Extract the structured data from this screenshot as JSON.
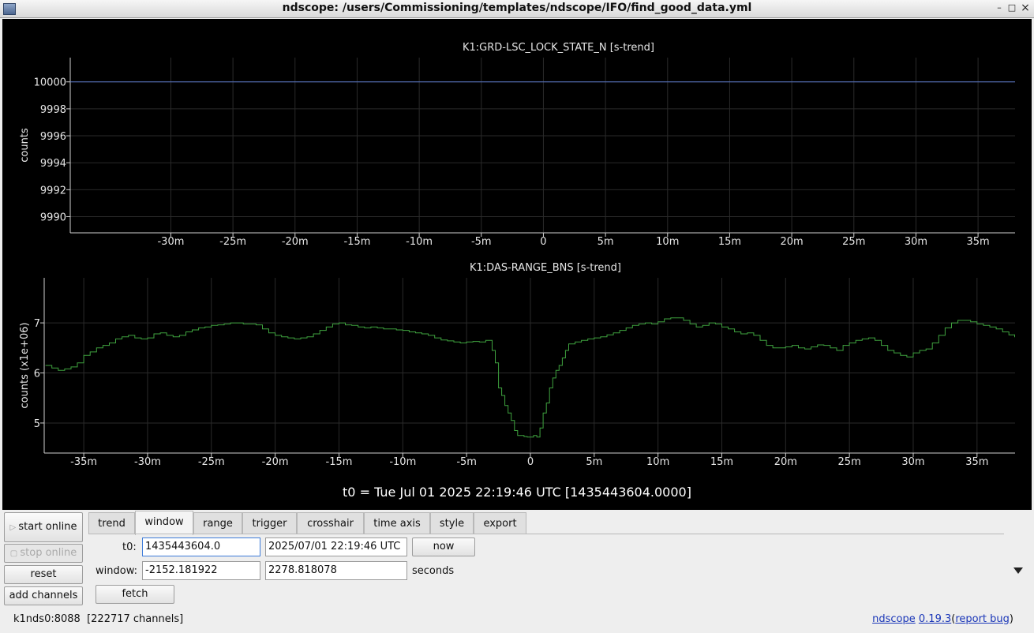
{
  "window": {
    "title": "ndscope: /users/Commissioning/templates/ndscope/IFO/find_good_data.yml",
    "minimize": "–",
    "maximize": "□",
    "close": "×"
  },
  "plots": [
    {
      "title": "K1:GRD-LSC_LOCK_STATE_N [s-trend]",
      "ylabel": "counts",
      "yticks": [
        "9990",
        "9992",
        "9994",
        "9996",
        "9998",
        "10000"
      ],
      "xticks": [
        "-30m",
        "-25m",
        "-20m",
        "-15m",
        "-10m",
        "-5m",
        "0",
        "5m",
        "10m",
        "15m",
        "20m",
        "25m",
        "30m",
        "35m"
      ]
    },
    {
      "title": "K1:DAS-RANGE_BNS [s-trend]",
      "ylabel": "counts (x1e+06)",
      "yticks": [
        "5",
        "6",
        "7"
      ],
      "xticks": [
        "-35m",
        "-30m",
        "-25m",
        "-20m",
        "-15m",
        "-10m",
        "-5m",
        "0",
        "5m",
        "10m",
        "15m",
        "20m",
        "25m",
        "30m",
        "35m"
      ]
    }
  ],
  "t0_label": "t0 = Tue Jul 01 2025 22:19:46 UTC [1435443604.0000]",
  "chart_data": [
    {
      "type": "line",
      "title": "K1:GRD-LSC_LOCK_STATE_N [s-trend]",
      "ylabel": "counts",
      "xunit": "minutes",
      "xlim": [
        -38.1,
        37.98
      ],
      "ylim": [
        9988.8,
        10001.8
      ],
      "grid": true,
      "color": "#5a78c8",
      "x": [
        -38.1,
        37.98
      ],
      "y": [
        10000,
        10000
      ]
    },
    {
      "type": "line",
      "title": "K1:DAS-RANGE_BNS [s-trend]",
      "ylabel": "counts (x1e+06)",
      "xunit": "minutes",
      "xlim": [
        -38.1,
        37.98
      ],
      "ylim": [
        4.4,
        7.9
      ],
      "grid": true,
      "color": "#3fa33f",
      "x": [
        -38.0,
        -37.5,
        -37.0,
        -36.5,
        -36.0,
        -35.5,
        -35.0,
        -34.5,
        -34.0,
        -33.5,
        -33.0,
        -32.5,
        -32.0,
        -31.5,
        -31.0,
        -30.5,
        -30.0,
        -29.5,
        -29.0,
        -28.5,
        -28.0,
        -27.5,
        -27.0,
        -26.5,
        -26.0,
        -25.5,
        -25.0,
        -24.5,
        -24.0,
        -23.5,
        -23.0,
        -22.5,
        -22.0,
        -21.5,
        -21.0,
        -20.5,
        -20.0,
        -19.5,
        -19.0,
        -18.5,
        -18.0,
        -17.5,
        -17.0,
        -16.5,
        -16.0,
        -15.5,
        -15.0,
        -14.5,
        -14.0,
        -13.5,
        -13.0,
        -12.5,
        -12.0,
        -11.5,
        -11.0,
        -10.5,
        -10.0,
        -9.5,
        -9.0,
        -8.5,
        -8.0,
        -7.5,
        -7.0,
        -6.5,
        -6.0,
        -5.5,
        -5.0,
        -4.5,
        -4.0,
        -3.5,
        -3.0,
        -2.75,
        -2.5,
        -2.25,
        -2.0,
        -1.75,
        -1.5,
        -1.25,
        -1.0,
        -0.75,
        -0.5,
        -0.25,
        0.0,
        0.25,
        0.5,
        0.75,
        1.0,
        1.25,
        1.5,
        1.75,
        2.0,
        2.25,
        2.5,
        2.75,
        3.0,
        3.5,
        4.0,
        4.5,
        5.0,
        5.5,
        6.0,
        6.5,
        7.0,
        7.5,
        8.0,
        8.5,
        9.0,
        9.5,
        10.0,
        10.5,
        11.0,
        11.5,
        12.0,
        12.5,
        13.0,
        13.5,
        14.0,
        14.5,
        15.0,
        15.5,
        16.0,
        16.5,
        17.0,
        17.5,
        18.0,
        18.5,
        19.0,
        19.5,
        20.0,
        20.5,
        21.0,
        21.5,
        22.0,
        22.5,
        23.0,
        23.5,
        24.0,
        24.5,
        25.0,
        25.5,
        26.0,
        26.5,
        27.0,
        27.5,
        28.0,
        28.5,
        29.0,
        29.5,
        30.0,
        30.5,
        31.0,
        31.5,
        32.0,
        32.5,
        33.0,
        33.5,
        34.0,
        34.5,
        35.0,
        35.5,
        36.0,
        36.5,
        37.0,
        37.5,
        37.95
      ],
      "y": [
        6.15,
        6.1,
        6.05,
        6.08,
        6.12,
        6.2,
        6.35,
        6.42,
        6.5,
        6.55,
        6.6,
        6.68,
        6.72,
        6.75,
        6.7,
        6.68,
        6.7,
        6.78,
        6.8,
        6.75,
        6.72,
        6.75,
        6.82,
        6.86,
        6.9,
        6.92,
        6.95,
        6.96,
        6.98,
        7.0,
        7.0,
        6.98,
        6.98,
        6.96,
        6.88,
        6.8,
        6.75,
        6.72,
        6.7,
        6.68,
        6.7,
        6.72,
        6.78,
        6.85,
        6.92,
        6.98,
        7.0,
        6.96,
        6.95,
        6.92,
        6.9,
        6.92,
        6.9,
        6.88,
        6.88,
        6.86,
        6.85,
        6.82,
        6.8,
        6.78,
        6.75,
        6.7,
        6.66,
        6.64,
        6.62,
        6.6,
        6.62,
        6.63,
        6.62,
        6.65,
        6.45,
        6.2,
        5.7,
        5.55,
        5.35,
        5.2,
        5.05,
        4.85,
        4.75,
        4.75,
        4.73,
        4.72,
        4.72,
        4.75,
        4.72,
        4.9,
        5.2,
        5.4,
        5.7,
        5.9,
        6.05,
        6.15,
        6.3,
        6.45,
        6.58,
        6.62,
        6.65,
        6.68,
        6.7,
        6.72,
        6.76,
        6.8,
        6.85,
        6.9,
        6.95,
        6.98,
        7.0,
        6.98,
        7.02,
        7.08,
        7.1,
        7.1,
        7.05,
        6.98,
        6.92,
        6.95,
        7.0,
        6.98,
        6.92,
        6.88,
        6.82,
        6.78,
        6.8,
        6.75,
        6.65,
        6.55,
        6.5,
        6.5,
        6.52,
        6.55,
        6.5,
        6.48,
        6.52,
        6.56,
        6.55,
        6.5,
        6.45,
        6.55,
        6.6,
        6.65,
        6.68,
        6.7,
        6.65,
        6.55,
        6.45,
        6.4,
        6.35,
        6.32,
        6.4,
        6.45,
        6.48,
        6.6,
        6.75,
        6.9,
        7.0,
        7.05,
        7.05,
        7.02,
        6.98,
        6.95,
        6.92,
        6.88,
        6.82,
        6.76,
        6.72,
        6.7,
        6.68,
        6.65,
        6.62,
        6.6,
        6.58
      ]
    }
  ],
  "sidebar": {
    "start_online": "start online",
    "stop_online": "stop online",
    "reset": "reset",
    "add_channels": "add channels"
  },
  "tabs": [
    "trend",
    "window",
    "range",
    "trigger",
    "crosshair",
    "time axis",
    "style",
    "export"
  ],
  "active_tab": "window",
  "window_tab": {
    "t0_label": "t0:",
    "t0_value": "1435443604.0",
    "t0_utc": "2025/07/01 22:19:46 UTC",
    "now_button": "now",
    "window_label": "window:",
    "window_start": "-2152.181922",
    "window_end": "2278.818078",
    "seconds_label": "seconds",
    "fetch_button": "fetch"
  },
  "status": {
    "server": "k1nds0:8088",
    "channels": "[222717 channels]",
    "app_name": "ndscope",
    "version": "0.19.3",
    "open_paren": "(",
    "report_bug": "report bug",
    "close_paren": ")"
  }
}
